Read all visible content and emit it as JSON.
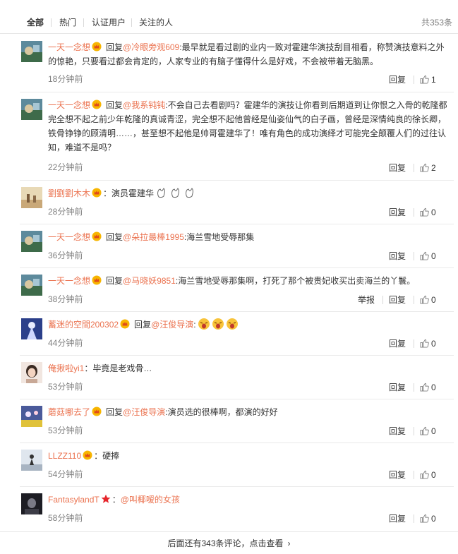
{
  "tabs": [
    {
      "label": "全部",
      "active": true
    },
    {
      "label": "热门",
      "active": false
    },
    {
      "label": "认证用户",
      "active": false
    },
    {
      "label": "关注的人",
      "active": false
    }
  ],
  "total": "共353条",
  "reply_label": "回复",
  "report_label": "举报",
  "reply_word": "回复",
  "comments": [
    {
      "user": "一天一念想",
      "reply_to": "@冷眼旁观609",
      "text_line1": "最早就是看过剧的业内一致对霍建华演技刮目相看，称赞演技意料之外",
      "text_rest": "的惊艳，只要看过都会肯定的，人家专业的有脑子懂得什么是好戏，不会被带着无脑黑。",
      "time": "18分钟前",
      "likes": "1"
    },
    {
      "user": "一天一念想",
      "reply_to": "@我系钝钝",
      "text_line1": "不会自己去看剧吗？霍建华的演技让你看到后期道到让你恨之入骨的乾隆",
      "text_rest": "都完全想不起之前少年乾隆的真诚青涩，完全想不起他曾经是仙姿仙气的白子画，曾经是深情纯良的徐长卿，铁骨铮铮的顾清明……，甚至想不起他是帅哥霍建华了！唯有角色的成功演绎才可能完全颠覆人们的过往认知，难道不是吗？",
      "time": "22分钟前",
      "likes": "2"
    },
    {
      "user": "劉劉劉木木",
      "reply_to": "",
      "text_line1": "演员霍建华",
      "text_rest": "",
      "time": "28分钟前",
      "likes": "0"
    },
    {
      "user": "一天一念想",
      "reply_to": "@朵拉最棒1995",
      "text_line1": "海兰雪地受辱那集",
      "text_rest": "",
      "time": "36分钟前",
      "likes": "0"
    },
    {
      "user": "一天一念想",
      "reply_to": "@马晓妖9851",
      "text_line1": "海兰雪地受辱那集啊，打死了那个被贵妃收买出卖海兰的丫鬟。",
      "text_rest": "",
      "time": "38分钟前",
      "likes": "0"
    },
    {
      "user": "蓄迷的空間200302",
      "reply_to": "@汪俊导演",
      "text_line1": "",
      "text_rest": "",
      "time": "44分钟前",
      "likes": "0"
    },
    {
      "user": "俺揪啦yi1",
      "reply_to": "",
      "text_line1": "毕竟是老戏骨…",
      "text_rest": "",
      "time": "53分钟前",
      "likes": "0"
    },
    {
      "user": "蘑菇哪去了",
      "reply_to": "@汪俊导演",
      "text_line1": "演员选的很棒啊，都演的好好",
      "text_rest": "",
      "time": "53分钟前",
      "likes": "0"
    },
    {
      "user": "LLZZ110",
      "reply_to": "",
      "text_line1": "硬捧",
      "text_rest": "",
      "time": "54分钟前",
      "likes": "0"
    },
    {
      "user": "FantasylandT",
      "reply_to": "",
      "text_line1": "@叫椰嗳的女孩",
      "text_rest": "",
      "time": "58分钟前",
      "likes": "0"
    }
  ],
  "more_text": "后面还有343条评论，点击查看",
  "colors": {
    "accent": "#eb7350",
    "muted": "#808080",
    "text": "#333333",
    "like_blue": "#5a8fd6"
  }
}
